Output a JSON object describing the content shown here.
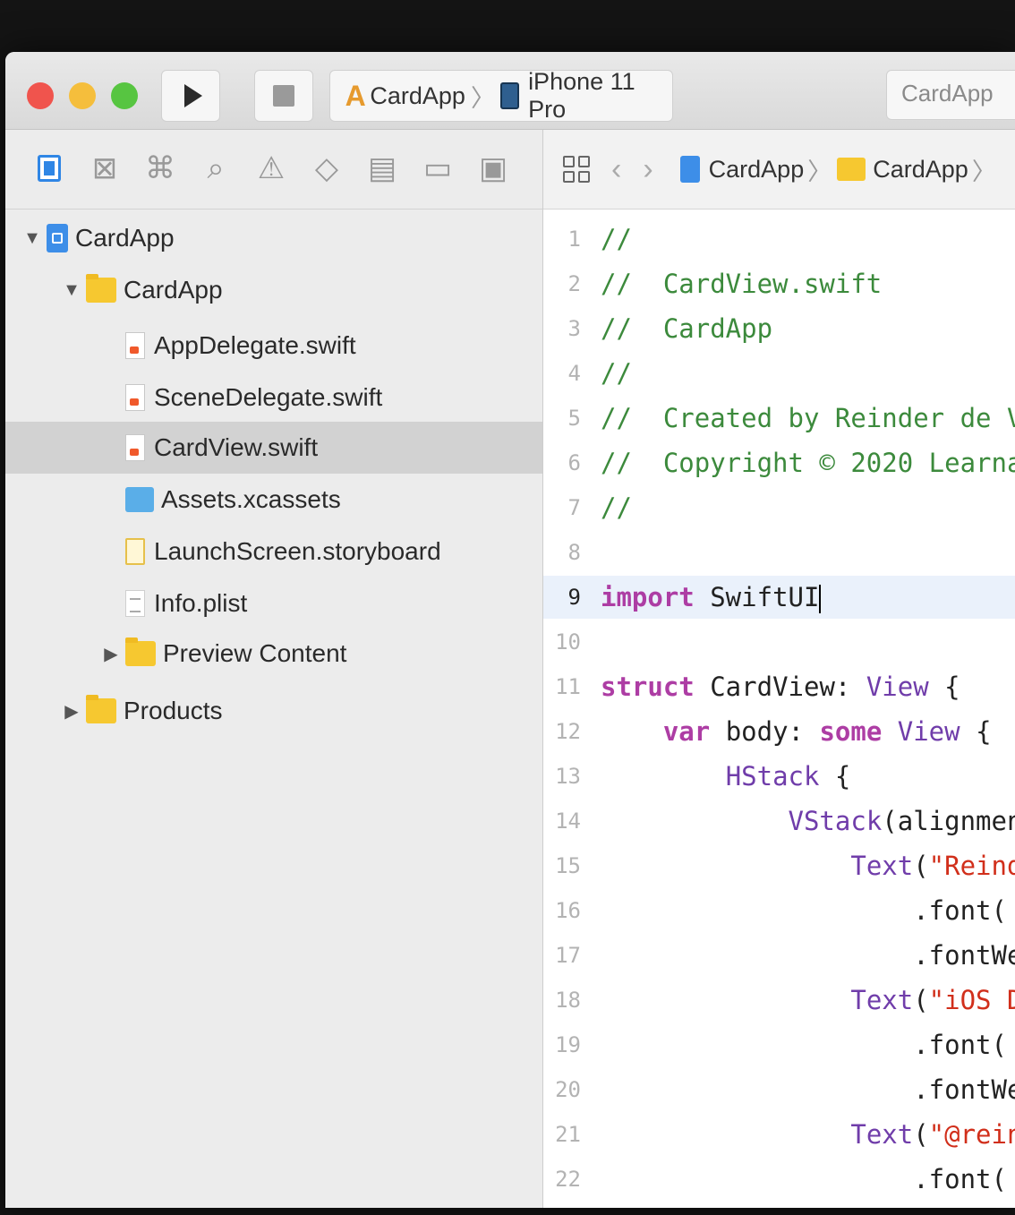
{
  "toolbar": {
    "scheme_name": "CardApp",
    "device_name": "iPhone 11 Pro",
    "status_text": "CardApp"
  },
  "navigator": {
    "tabs": [
      {
        "name": "project-navigator-tab",
        "icon": "folder-icon",
        "active": true
      },
      {
        "name": "source-control-tab",
        "icon": "source-control-icon",
        "active": false
      },
      {
        "name": "symbol-navigator-tab",
        "icon": "hierarchy-icon",
        "active": false
      },
      {
        "name": "find-navigator-tab",
        "icon": "search-icon",
        "active": false
      },
      {
        "name": "issue-navigator-tab",
        "icon": "warning-icon",
        "active": false
      },
      {
        "name": "test-navigator-tab",
        "icon": "diamond-icon",
        "active": false
      },
      {
        "name": "debug-navigator-tab",
        "icon": "gauge-icon",
        "active": false
      },
      {
        "name": "breakpoint-navigator-tab",
        "icon": "breakpoint-icon",
        "active": false
      },
      {
        "name": "report-navigator-tab",
        "icon": "report-icon",
        "active": false
      }
    ],
    "tree": [
      {
        "label": "CardApp",
        "kind": "project",
        "depth": 0,
        "disclosure": "open",
        "selected": false
      },
      {
        "label": "CardApp",
        "kind": "folder",
        "depth": 1,
        "disclosure": "open",
        "selected": false
      },
      {
        "label": "AppDelegate.swift",
        "kind": "swift",
        "depth": 2,
        "disclosure": "",
        "selected": false
      },
      {
        "label": "SceneDelegate.swift",
        "kind": "swift",
        "depth": 2,
        "disclosure": "",
        "selected": false
      },
      {
        "label": "CardView.swift",
        "kind": "swift",
        "depth": 2,
        "disclosure": "",
        "selected": true
      },
      {
        "label": "Assets.xcassets",
        "kind": "assets",
        "depth": 2,
        "disclosure": "",
        "selected": false
      },
      {
        "label": "LaunchScreen.storyboard",
        "kind": "storyboard",
        "depth": 2,
        "disclosure": "",
        "selected": false
      },
      {
        "label": "Info.plist",
        "kind": "plist",
        "depth": 2,
        "disclosure": "",
        "selected": false
      },
      {
        "label": "Preview Content",
        "kind": "folder",
        "depth": 2,
        "disclosure": "closed",
        "selected": false
      },
      {
        "label": "Products",
        "kind": "folder",
        "depth": 1,
        "disclosure": "closed",
        "selected": false
      }
    ]
  },
  "editor": {
    "breadcrumb": [
      "CardApp",
      "CardApp"
    ],
    "current_line": 9,
    "lines": [
      {
        "n": "1",
        "tokens": [
          [
            "comment",
            "//"
          ]
        ]
      },
      {
        "n": "2",
        "tokens": [
          [
            "comment",
            "//  CardView.swift"
          ]
        ]
      },
      {
        "n": "3",
        "tokens": [
          [
            "comment",
            "//  CardApp"
          ]
        ]
      },
      {
        "n": "4",
        "tokens": [
          [
            "comment",
            "//"
          ]
        ]
      },
      {
        "n": "5",
        "tokens": [
          [
            "comment",
            "//  Created by Reinder de V"
          ]
        ]
      },
      {
        "n": "6",
        "tokens": [
          [
            "comment",
            "//  Copyright © 2020 Learna"
          ]
        ]
      },
      {
        "n": "7",
        "tokens": [
          [
            "comment",
            "//"
          ]
        ]
      },
      {
        "n": "8",
        "tokens": []
      },
      {
        "n": "9",
        "tokens": [
          [
            "keyword",
            "import"
          ],
          [
            "plain",
            " SwiftUI"
          ]
        ]
      },
      {
        "n": "10",
        "tokens": []
      },
      {
        "n": "11",
        "tokens": [
          [
            "keyword",
            "struct"
          ],
          [
            "plain",
            " CardView: "
          ],
          [
            "type",
            "View"
          ],
          [
            "plain",
            " {"
          ]
        ]
      },
      {
        "n": "12",
        "tokens": [
          [
            "plain",
            "    "
          ],
          [
            "keyword",
            "var"
          ],
          [
            "plain",
            " body: "
          ],
          [
            "keyword",
            "some"
          ],
          [
            "plain",
            " "
          ],
          [
            "type",
            "View"
          ],
          [
            "plain",
            " {"
          ]
        ]
      },
      {
        "n": "13",
        "tokens": [
          [
            "plain",
            "        "
          ],
          [
            "type",
            "HStack"
          ],
          [
            "plain",
            " {"
          ]
        ]
      },
      {
        "n": "14",
        "tokens": [
          [
            "plain",
            "            "
          ],
          [
            "type",
            "VStack"
          ],
          [
            "plain",
            "(alignmen"
          ]
        ]
      },
      {
        "n": "15",
        "tokens": [
          [
            "plain",
            "                "
          ],
          [
            "type",
            "Text"
          ],
          [
            "plain",
            "("
          ],
          [
            "string",
            "\"Reind"
          ]
        ]
      },
      {
        "n": "16",
        "tokens": [
          [
            "plain",
            "                    .font("
          ]
        ]
      },
      {
        "n": "17",
        "tokens": [
          [
            "plain",
            "                    .fontWe"
          ]
        ]
      },
      {
        "n": "18",
        "tokens": [
          [
            "plain",
            "                "
          ],
          [
            "type",
            "Text"
          ],
          [
            "plain",
            "("
          ],
          [
            "string",
            "\"iOS D"
          ]
        ]
      },
      {
        "n": "19",
        "tokens": [
          [
            "plain",
            "                    .font("
          ]
        ]
      },
      {
        "n": "20",
        "tokens": [
          [
            "plain",
            "                    .fontWe"
          ]
        ]
      },
      {
        "n": "21",
        "tokens": [
          [
            "plain",
            "                "
          ],
          [
            "type",
            "Text"
          ],
          [
            "plain",
            "("
          ],
          [
            "string",
            "\"@rein"
          ]
        ]
      },
      {
        "n": "22",
        "tokens": [
          [
            "plain",
            "                    .font("
          ]
        ]
      }
    ]
  },
  "colors": {
    "comment": "#3c8a3c",
    "keyword": "#ad3da4",
    "type": "#703daa",
    "string": "#d12f1b",
    "selection": "#d2d2d2",
    "accent": "#2f86e5"
  }
}
